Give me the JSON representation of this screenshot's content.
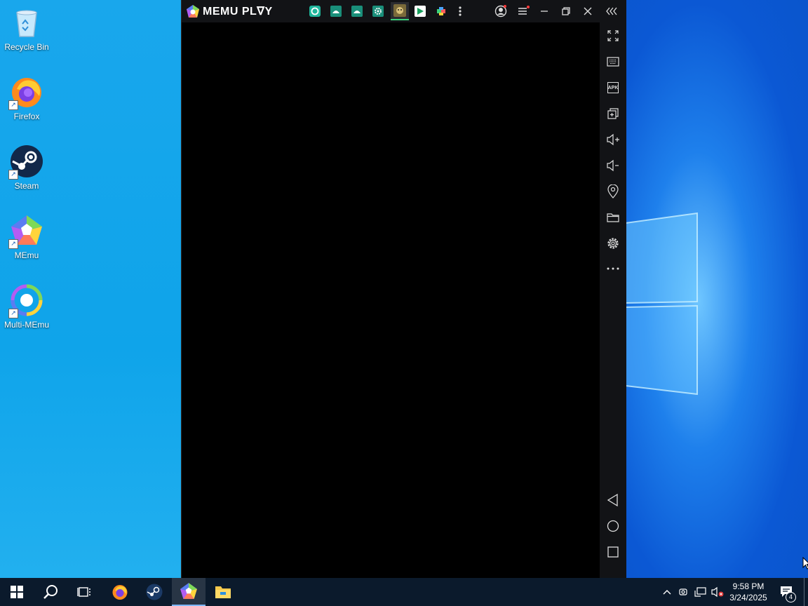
{
  "desktop": {
    "icons": [
      {
        "label": "Recycle Bin",
        "icon": "recycle-bin-icon"
      },
      {
        "label": "Firefox",
        "icon": "firefox-icon"
      },
      {
        "label": "Steam",
        "icon": "steam-icon"
      },
      {
        "label": "MEmu",
        "icon": "memu-icon"
      },
      {
        "label": "Multi-MEmu",
        "icon": "multi-memu-icon"
      }
    ]
  },
  "memu": {
    "brand": "MEMU PL∇Y",
    "tabs": [
      "play-store-circle-icon",
      "android-icon",
      "android-icon",
      "settings-app-icon",
      "game-app-icon",
      "google-play-icon",
      "puzzle-icon"
    ],
    "sidebar": [
      "fullscreen",
      "keyboard",
      "apk-install",
      "multi-window",
      "volume-up",
      "volume-down",
      "location",
      "folder",
      "settings",
      "more"
    ],
    "apk_label": "APK",
    "nav": [
      "back",
      "home",
      "recent"
    ],
    "colors": {
      "titlebar": "#121316",
      "screen": "#000000"
    }
  },
  "taskbar": {
    "time": "9:58 PM",
    "date": "3/24/2025",
    "notification_count": "4"
  }
}
